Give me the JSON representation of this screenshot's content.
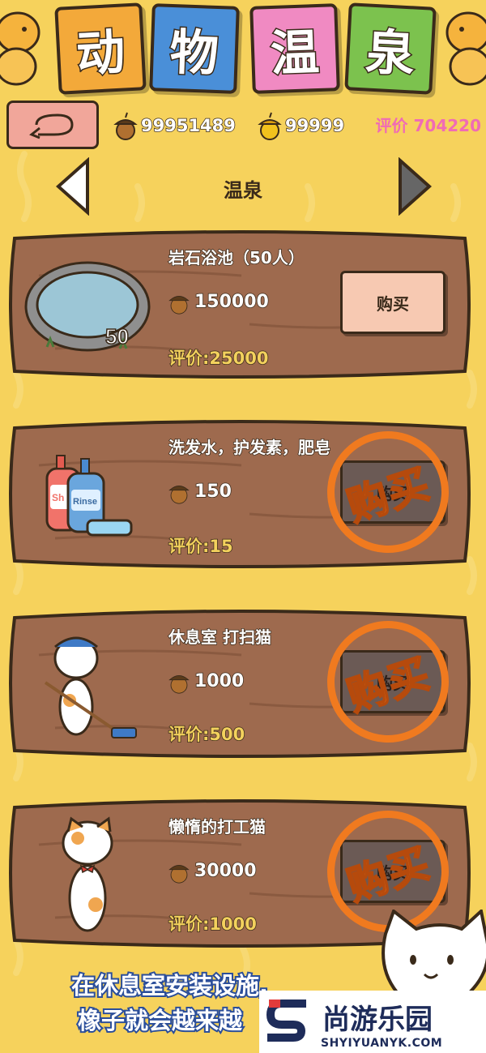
{
  "header": {
    "title_chars": [
      "动",
      "物",
      "温",
      "泉"
    ],
    "title_colors": [
      "#f3a93a",
      "#4a8fd8",
      "#f08ac2",
      "#7cc24e"
    ],
    "acorns": "99951489",
    "golden_acorns": "99999",
    "rating_label": "评价 704220"
  },
  "nav": {
    "category_title": "温泉"
  },
  "items": [
    {
      "name": "岩石浴池（50人）",
      "price": "150000",
      "rating": "评价:25000",
      "buy_label": "购买",
      "image": "rock-pool",
      "pool_capacity": "50",
      "sold": false
    },
    {
      "name": "洗发水，护发素，肥皂",
      "price": "150",
      "rating": "评价:15",
      "buy_label": "购买",
      "image": "shampoo-bottles",
      "bottle_label_1": "Sh",
      "bottle_label_2": "Rinse",
      "sold": true
    },
    {
      "name": "休息室 打扫猫",
      "price": "1000",
      "rating": "评价:500",
      "buy_label": "购买",
      "image": "cleaning-cat",
      "sold": true
    },
    {
      "name": "懒惰的打工猫",
      "price": "30000",
      "rating": "评价:1000",
      "buy_label": "购买",
      "image": "lazy-cat",
      "sold": true
    }
  ],
  "stamp_text": "购买",
  "caption": {
    "line1": "在休息室安装设施,",
    "line2": "橡子就会越来越"
  },
  "watermark": {
    "text": "尚游乐园",
    "sub": "SHYIYUANYK.COM"
  },
  "colors": {
    "background": "#f6d25c",
    "wood": "#9e6a4e",
    "stamp": "#f07a1f",
    "rating_pink": "#f06bb5"
  }
}
